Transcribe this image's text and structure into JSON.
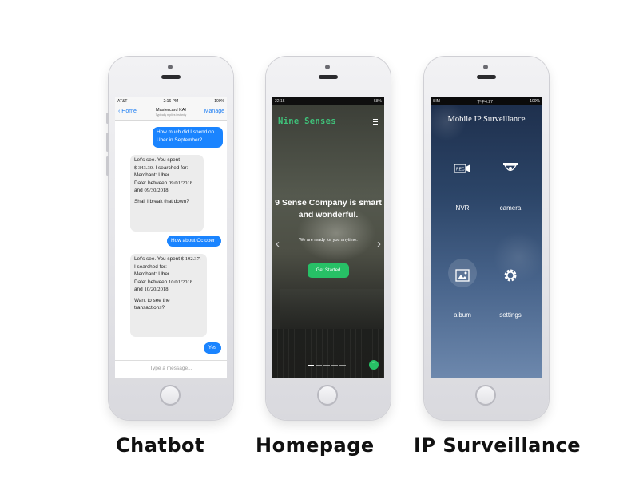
{
  "chatbot": {
    "status": {
      "carrier": "AT&T",
      "time": "2:16 PM",
      "battery": "100%"
    },
    "header": {
      "back": "Home",
      "title": "Mastercard KAI",
      "subtitle": "Typically replies instantly",
      "manage": "Manage"
    },
    "messages": [
      {
        "from": "user",
        "text": "How much did I spend on Uber in September?"
      },
      {
        "from": "bot",
        "lines": [
          "Let's see. You spent",
          "$ 343.30.",
          "I searched for:",
          "Merchant: Uber",
          "Date: between",
          "09/01/2018",
          "and",
          "09/30/2018",
          "Shall I break that down?"
        ]
      },
      {
        "from": "user",
        "text": "How about October"
      },
      {
        "from": "bot",
        "lines": [
          "Let's see. You spent",
          "$ 192.37.",
          "I searched for:",
          "Merchant: Uber",
          "Date: between",
          "10/01/2018",
          "and",
          "10/20/2018",
          "Want to see the",
          "transactions?"
        ]
      },
      {
        "from": "user",
        "text": "Yes"
      }
    ],
    "input_placeholder": "Type a message..."
  },
  "homepage": {
    "status": {
      "time": "22:15",
      "battery": "58%"
    },
    "brand": "Nine Senses",
    "hero_title": "9 Sense Company is smart and wonderful.",
    "hero_subtitle": "We are ready for you anytime.",
    "cta": "Get Started"
  },
  "surveillance": {
    "status": {
      "carrier": "SIM",
      "time": "下午4:27",
      "battery": "100%"
    },
    "title": "Mobile IP Surveillance",
    "tiles": [
      {
        "label": "NVR",
        "icon": "rec-camera-icon"
      },
      {
        "label": "camera",
        "icon": "dome-camera-icon"
      },
      {
        "label": "album",
        "icon": "photo-album-icon"
      },
      {
        "label": "settings",
        "icon": "gear-icon"
      }
    ]
  },
  "captions": {
    "chatbot": "Chatbot",
    "homepage": "Homepage",
    "surveillance": "IP Surveillance"
  },
  "colors": {
    "ios_blue": "#1a84ff",
    "brand_green": "#27c066",
    "surveillance_bg": "#2c4568"
  }
}
